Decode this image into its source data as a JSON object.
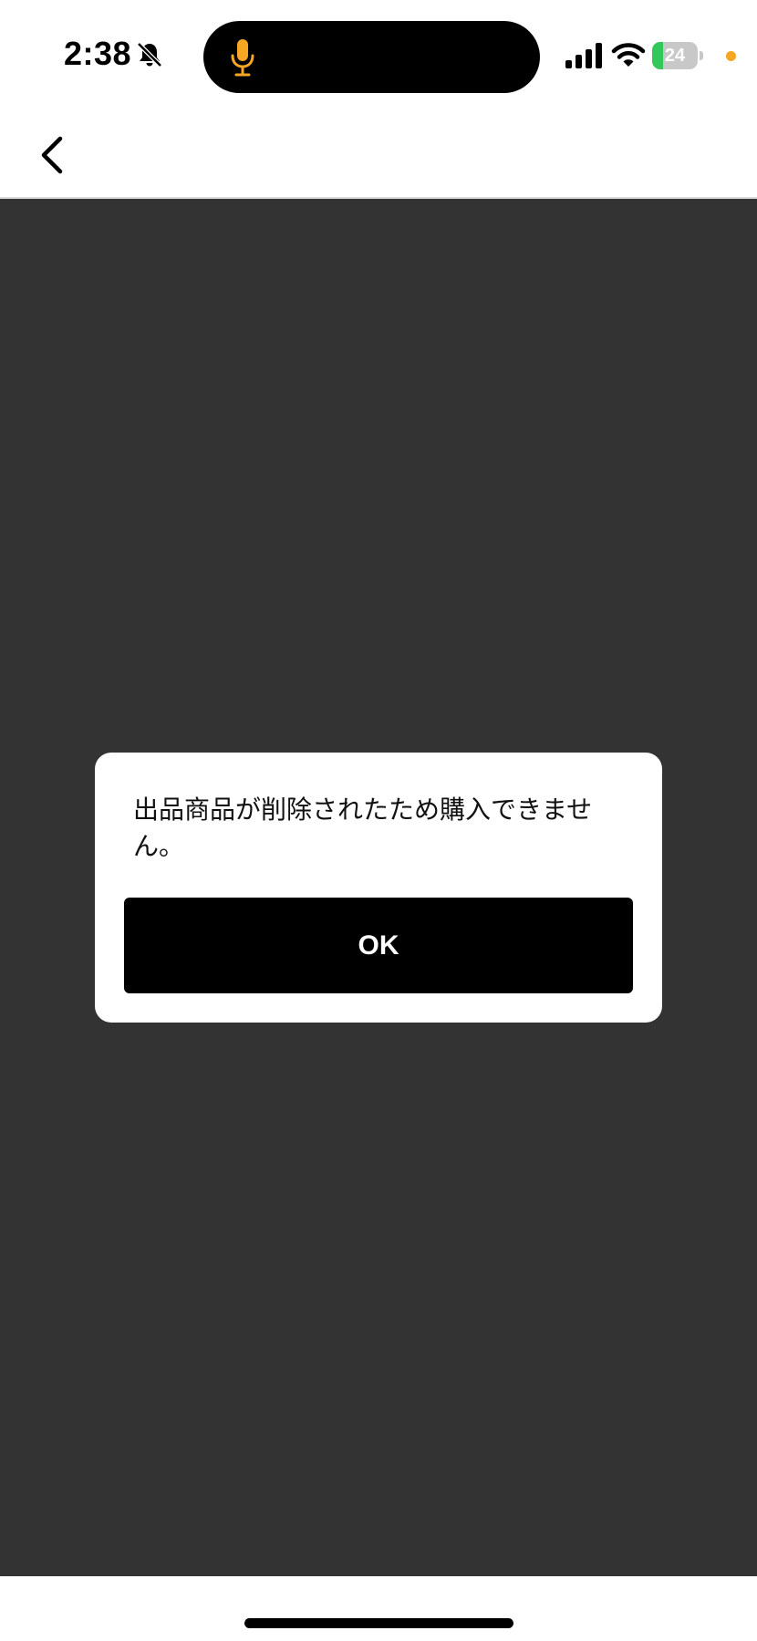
{
  "status_bar": {
    "time": "2:38",
    "battery_level": "24",
    "battery_percent": 24,
    "icons": [
      "bell-slash-icon",
      "microphone-icon",
      "cellular-signal-icon",
      "wifi-icon",
      "battery-charging-icon"
    ],
    "mic_color": "#f5a623",
    "privacy_dot_color": "#f5a623",
    "battery_color": "#34c759"
  },
  "nav": {
    "back_icon": "chevron-left-icon"
  },
  "dialog": {
    "message": "出品商品が削除されたため購入できません。",
    "ok_label": "OK"
  },
  "colors": {
    "overlay": "#333333",
    "button_bg": "#000000",
    "button_text": "#ffffff"
  }
}
